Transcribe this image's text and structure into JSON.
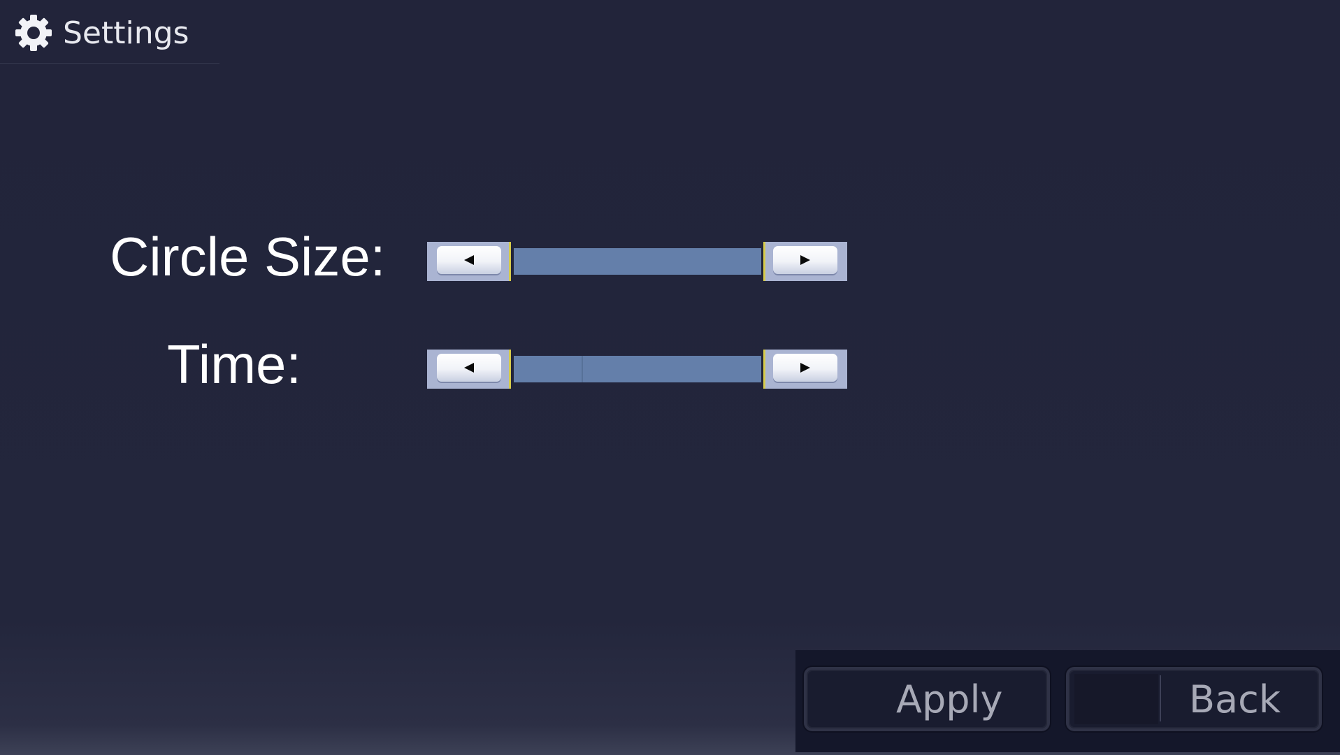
{
  "header": {
    "title": "Settings",
    "icon": "gear-icon"
  },
  "settings": [
    {
      "id": "circle-size",
      "label": "Circle Size:",
      "level": 1.0
    },
    {
      "id": "time",
      "label": "Time:",
      "level": 0.28
    }
  ],
  "buttons": {
    "apply_label": "Apply",
    "back_label": "Back"
  },
  "colors": {
    "background": "#23253b",
    "slider_track": "#647faa",
    "slider_button": "#aab4d2",
    "slider_focus": "#d6cb4b",
    "text": "#ffffff"
  }
}
